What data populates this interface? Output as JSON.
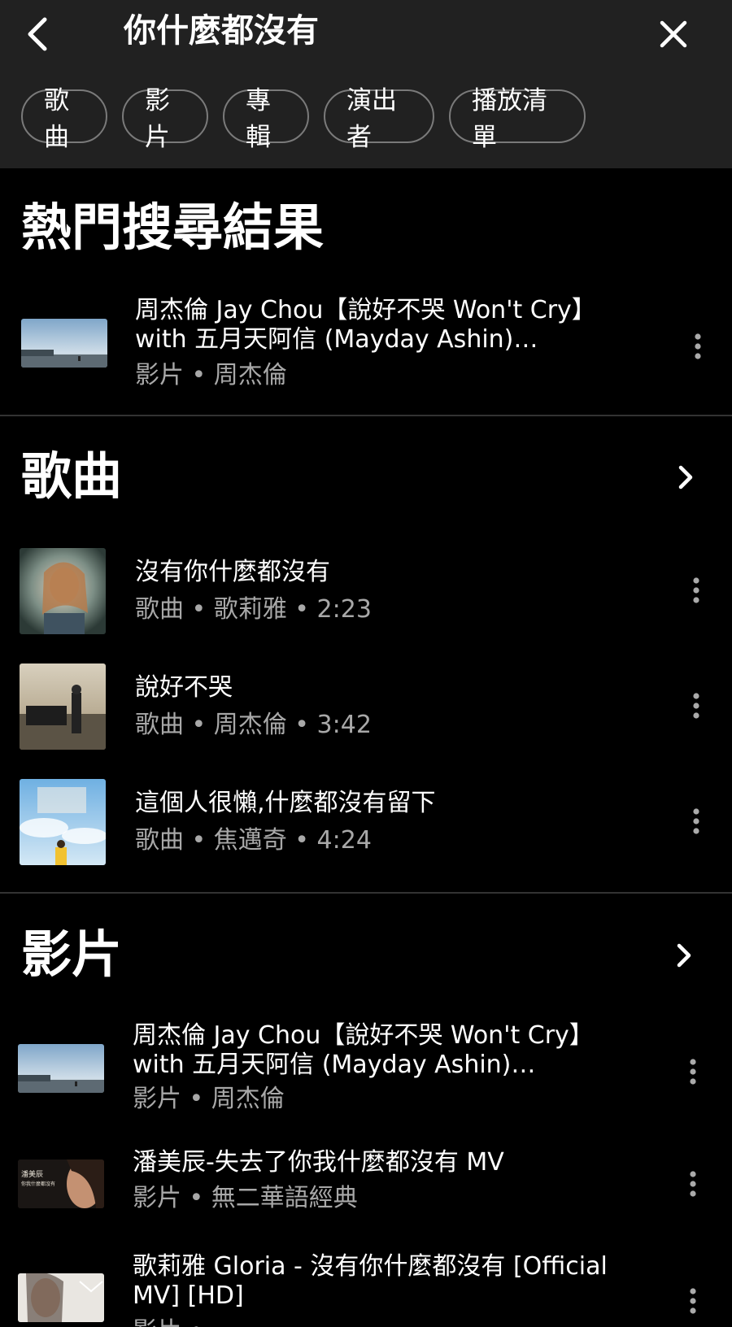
{
  "header": {
    "query": "你什麼都沒有",
    "back_icon": "back-arrow-icon",
    "close_icon": "close-icon",
    "chips": [
      "歌曲",
      "影片",
      "專輯",
      "演出者",
      "播放清單"
    ]
  },
  "top_result": {
    "section_title": "熱門搜尋結果",
    "item": {
      "title": "周杰倫 Jay Chou【說好不哭 Won't Cry】with 五月天阿信 (Mayday Ashin) Official...",
      "meta": "影片 • 周杰倫"
    }
  },
  "songs": {
    "section_title": "歌曲",
    "items": [
      {
        "title": "沒有你什麼都沒有",
        "meta": "歌曲 • 歌莉雅 • 2:23"
      },
      {
        "title": "說好不哭",
        "meta": "歌曲 • 周杰倫 • 3:42"
      },
      {
        "title": "這個人很懶,什麼都沒有留下",
        "meta": "歌曲 • 焦邁奇 • 4:24"
      }
    ]
  },
  "videos": {
    "section_title": "影片",
    "items": [
      {
        "title": "周杰倫 Jay Chou【說好不哭 Won't Cry】with 五月天阿信 (Mayday Ashin) Official...",
        "meta": "影片 • 周杰倫"
      },
      {
        "title": "潘美辰-失去了你我什麼都沒有 MV",
        "meta": "影片 • 無二華語經典",
        "thumb_text": [
          "潘美辰",
          "你我什麼都沒有"
        ]
      },
      {
        "title": "歌莉雅 Gloria - 沒有你什麼都沒有 [Official MV] [HD]",
        "meta": "影片 • ..."
      }
    ]
  },
  "colors": {
    "background": "#000000",
    "header": "#212121",
    "secondary_text": "#a8a8a8",
    "chip_border": "#7a7a7a"
  }
}
